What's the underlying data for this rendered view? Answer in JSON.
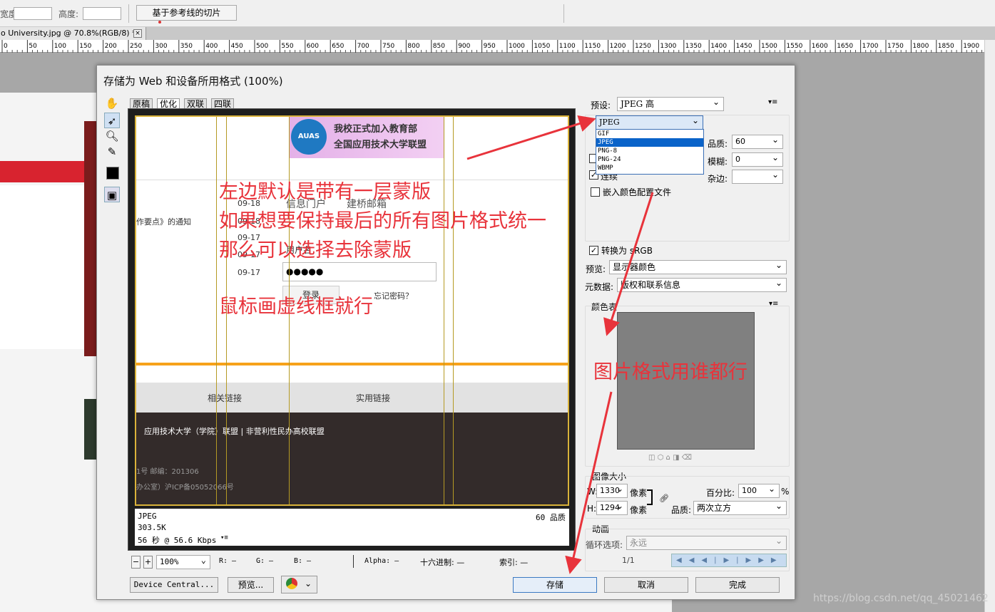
{
  "options_bar": {
    "width_label": "宽度:",
    "height_label": "高度:",
    "slice_button": "基于参考线的切片"
  },
  "document_tab": {
    "title": "o University.jpg @ 70.8%(RGB/8) *",
    "close": "×"
  },
  "ruler": {
    "ticks": [
      "0",
      "50",
      "100",
      "150",
      "200",
      "250",
      "300",
      "350",
      "400",
      "450",
      "500",
      "550",
      "600",
      "650",
      "700",
      "750",
      "800",
      "850",
      "900",
      "950",
      "1000",
      "1050",
      "1100",
      "1150",
      "1200",
      "1250",
      "1300",
      "1350",
      "1400",
      "1450",
      "1500",
      "1550",
      "1600",
      "1650",
      "1700",
      "1750",
      "1800",
      "1850",
      "1900"
    ]
  },
  "dialog": {
    "title": "存储为 Web 和设备所用格式 (100%)",
    "tabs": [
      "原稿",
      "优化",
      "双联",
      "四联"
    ],
    "preview": {
      "banner_text_1": "我校正式加入教育部",
      "banner_text_2": "全国应用技术大学联盟",
      "banner_logo": "AUAS",
      "dates": [
        "09-18",
        "09-18",
        "09-17",
        "09-17",
        "09-17"
      ],
      "notice": "作要点》的通知",
      "portal": "信息门户",
      "mail": "建桥邮箱",
      "username": "用户名",
      "password": "●●●●●",
      "login": "登录",
      "forgot": "忘记密码？",
      "links_related": "相关链接",
      "links_useful": "实用链接",
      "footer_line1": "应用技术大学（学院）联盟 | 非营利性民办高校联盟",
      "footer_line2": "1号 邮编：201306",
      "footer_line3": "办公室）沪ICP备05052066号"
    },
    "preview_info": {
      "format": "JPEG",
      "size": "303.5K",
      "time": "56 秒 @ 56.6 Kbps",
      "quality": "60 品质"
    },
    "bottom_bar": {
      "zoom": "100%",
      "r": "R: —",
      "g": "G: —",
      "b": "B: —",
      "alpha": "Alpha: —",
      "hex": "十六进制: —",
      "index": "索引: —"
    },
    "settings": {
      "preset_label": "预设:",
      "preset_value": "JPEG 高",
      "format_value": "JPEG",
      "format_options": [
        "GIF",
        "JPEG",
        "PNG-8",
        "PNG-24",
        "WBMP"
      ],
      "quality_label": "品质:",
      "quality_value": "60",
      "blur_label": "模糊:",
      "blur_value": "0",
      "matte_label": "杂边:",
      "progressive_label": "连续",
      "embed_profile_label": "嵌入颜色配置文件",
      "convert_label": "转换为 sRGB",
      "preview_label": "预览:",
      "preview_value": "显示器颜色",
      "metadata_label": "元数据:",
      "metadata_value": "版权和联系信息",
      "color_table_label": "颜色表",
      "image_size_label": "图像大小",
      "width_label": "W:",
      "width_value": "1330",
      "height_label": "H:",
      "height_value": "1294",
      "pixels": "像素",
      "percent_label": "百分比:",
      "percent_value": "100",
      "percent_unit": "%",
      "quality2_label": "品质:",
      "quality2_value": "两次立方",
      "animation_label": "动画",
      "loop_label": "循环选项:",
      "loop_value": "永远",
      "frame": "1/1"
    },
    "buttons": {
      "device_central": "Device Central...",
      "preview": "预览...",
      "save": "存储",
      "cancel": "取消",
      "done": "完成"
    }
  },
  "annotations": {
    "left_1": "左边默认是带有一层蒙版",
    "left_2": "如果想要保持最后的所有图片格式统一",
    "left_3": "那么可以选择去除蒙版",
    "left_4": "鼠标画虚线框就行",
    "right": "图片格式用谁都行",
    "accent_color": "#e8333b"
  },
  "watermark": "https://blog.csdn.net/qq_45021462"
}
